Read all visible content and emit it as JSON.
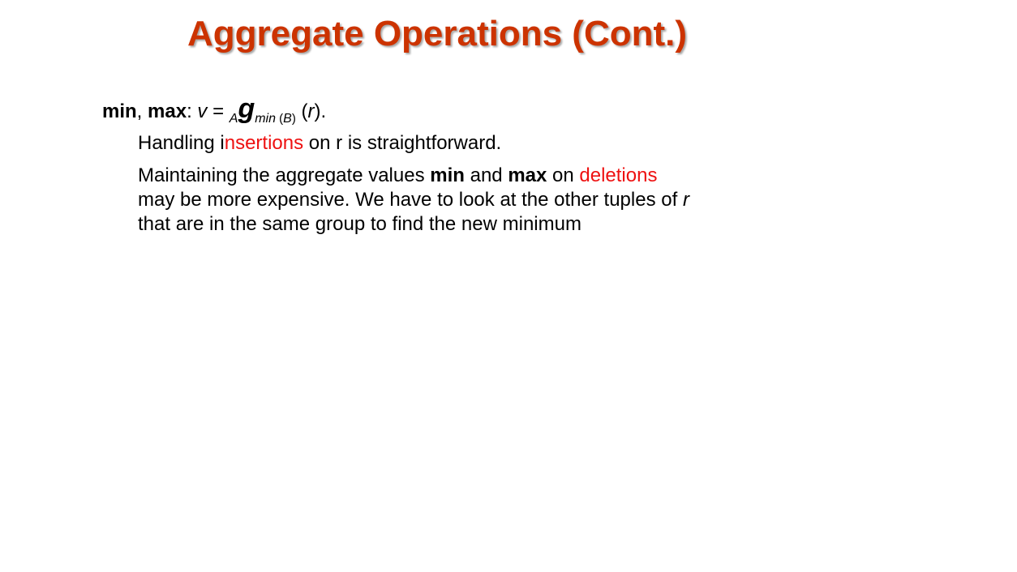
{
  "slide": {
    "title": "Aggregate Operations (Cont.)",
    "main": {
      "min_label": "min",
      "comma": ", ",
      "max_label": "max",
      "colon": ": ",
      "v": "v",
      "equals": " = ",
      "sub_a": "A",
      "g": "g",
      "sub_min": "min",
      "sub_paren_open": " (",
      "sub_b": "B",
      "sub_paren_close": ")",
      "arg_open": " (",
      "arg_r": "r",
      "arg_close": ")."
    },
    "p1": {
      "part1": "Handling i",
      "red": "nsertions",
      "part2": " on r is straightforward."
    },
    "p2": {
      "part1": "Maintaining the aggregate values ",
      "min": "min",
      "and": " and ",
      "max": "max",
      "on": " on ",
      "red": "deletions",
      "line2": "may be more expensive.  We have to look at the other tuples of ",
      "line2_r": "r",
      "line3": "that are in the same group to find the new minimum"
    }
  },
  "colors": {
    "title": "#cc3300",
    "highlight": "#ee1111",
    "text": "#000000"
  }
}
